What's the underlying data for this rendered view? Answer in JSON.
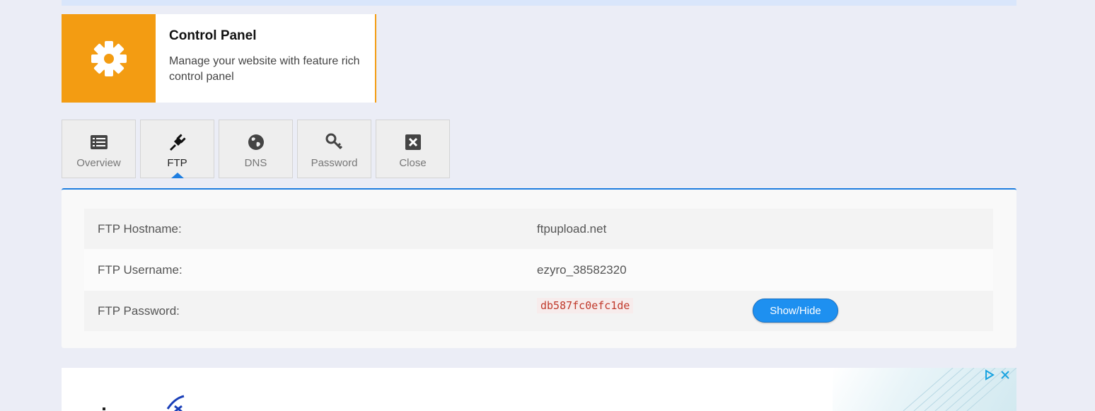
{
  "control_panel": {
    "title": "Control Panel",
    "description": "Manage your website with feature rich control panel",
    "accent_color": "#f39c12"
  },
  "tabs": [
    {
      "label": "Overview",
      "icon": "list-icon",
      "active": false
    },
    {
      "label": "FTP",
      "icon": "plug-icon",
      "active": true
    },
    {
      "label": "DNS",
      "icon": "globe-icon",
      "active": false
    },
    {
      "label": "Password",
      "icon": "key-icon",
      "active": false
    },
    {
      "label": "Close",
      "icon": "close-box-icon",
      "active": false
    }
  ],
  "ftp": {
    "hostname_label": "FTP Hostname:",
    "hostname_value": "ftpupload.net",
    "username_label": "FTP Username:",
    "username_value": "ezyro_38582320",
    "password_label": "FTP Password:",
    "password_value": "db587fc0efc1de",
    "show_hide_label": "Show/Hide"
  },
  "ad": {
    "controls": [
      "adchoices-icon",
      "close-icon"
    ]
  },
  "colors": {
    "tab_accent": "#1e7ee0",
    "button": "#1e90f0",
    "background": "#ebedf6"
  }
}
